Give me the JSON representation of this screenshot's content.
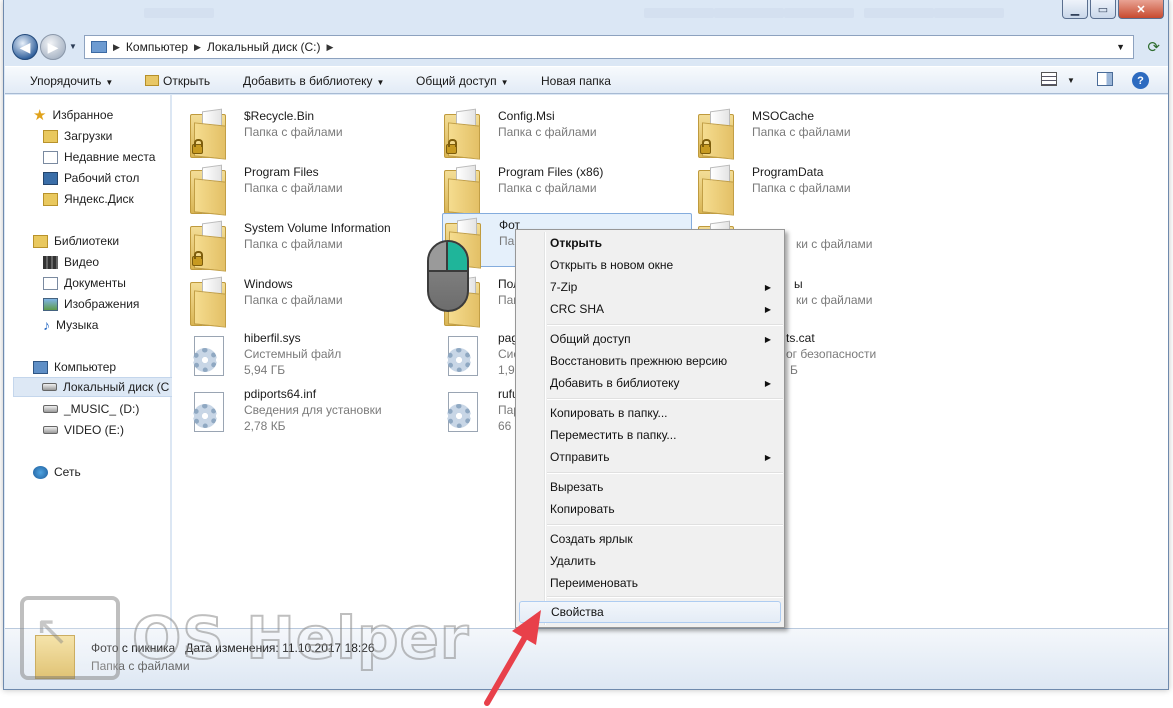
{
  "address": {
    "crumbs": [
      "Компьютер",
      "Локальный диск (C:)"
    ]
  },
  "toolbar": {
    "organize": "Упорядочить",
    "open": "Открыть",
    "add_library": "Добавить в библиотеку",
    "share": "Общий доступ",
    "new_folder": "Новая папка"
  },
  "sidebar": {
    "favorites": "Избранное",
    "downloads": "Загрузки",
    "recent": "Недавние места",
    "desktop": "Рабочий стол",
    "yandex": "Яндекс.Диск",
    "libraries": "Библиотеки",
    "video": "Видео",
    "documents": "Документы",
    "images": "Изображения",
    "music": "Музыка",
    "computer": "Компьютер",
    "local_disk": "Локальный диск (C",
    "music_drive": "_MUSIC_ (D:)",
    "video_drive": "VIDEO (E:)",
    "network": "Сеть"
  },
  "files": [
    {
      "name": "$Recycle.Bin",
      "sub": "Папка с файлами"
    },
    {
      "name": "Config.Msi",
      "sub": "Папка с файлами"
    },
    {
      "name": "MSOCache",
      "sub": "Папка с файлами"
    },
    {
      "name": "Program Files",
      "sub": "Папка с файлами"
    },
    {
      "name": "Program Files (x86)",
      "sub": "Папка с файлами"
    },
    {
      "name": "ProgramData",
      "sub": "Папка с файлами"
    },
    {
      "name": "System Volume Information",
      "sub": "Папка с файлами"
    },
    {
      "name": "Фот",
      "sub": "Папк"
    },
    {
      "name": "",
      "sub": "ки с файлами"
    },
    {
      "name": "Windows",
      "sub": "Папка с файлами"
    },
    {
      "name": "Пол",
      "sub": "Папк"
    },
    {
      "name": "ы",
      "sub": "ки с файлами"
    },
    {
      "name": "hiberfil.sys",
      "sub": "Системный файл",
      "size": "5,94 ГБ"
    },
    {
      "name": "pag",
      "sub": "Сист",
      "size": "1,95"
    },
    {
      "name": "ts.cat",
      "sub": "ог безопасности",
      "size": "Б"
    },
    {
      "name": "pdiports64.inf",
      "sub": "Сведения для установки",
      "size": "2,78 КБ"
    },
    {
      "name": "rufu",
      "sub": "Пара",
      "size": "66 6"
    }
  ],
  "context_menu": {
    "open": "Открыть",
    "open_new_window": "Открыть в новом окне",
    "zip": "7-Zip",
    "crc": "CRC SHA",
    "share": "Общий доступ",
    "restore": "Восстановить прежнюю версию",
    "add_library": "Добавить в библиотеку",
    "copy_to": "Копировать в папку...",
    "move_to": "Переместить в папку...",
    "send": "Отправить",
    "cut": "Вырезать",
    "copy": "Копировать",
    "shortcut": "Создать ярлык",
    "delete": "Удалить",
    "rename": "Переименовать",
    "properties": "Свойства"
  },
  "status": {
    "name": "Фото с пикника",
    "modified": "Дата изменения: 11.10.2017 18:26",
    "sub": "Папка с файлами"
  },
  "watermark": {
    "text": "OS Helper"
  },
  "colors": {
    "accent_arrow": "#e8404a",
    "mouse_button": "#1fb59a",
    "selection": "#e5f0fb"
  }
}
